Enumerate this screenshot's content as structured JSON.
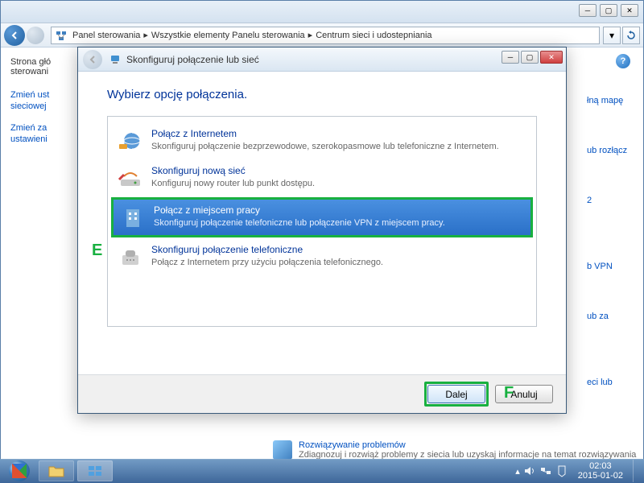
{
  "breadcrumb": {
    "item1": "Panel sterowania",
    "item2": "Wszystkie elementy Panelu sterowania",
    "item3": "Centrum sieci i udostepniania",
    "sep": " ▸ "
  },
  "sidebar": {
    "home1": "Strona głó",
    "home2": "sterowani",
    "link1a": "Zmień ust",
    "link1b": "sieciowej",
    "link2a": "Zmień za",
    "link2b": "ustawieni"
  },
  "right": {
    "r1": "łną mapę",
    "r2": "ub rozłącz",
    "r3": "2",
    "r4": "b VPN",
    "r5": "ub za",
    "r6": "eci lub"
  },
  "bottom": {
    "link": "Rozwiązywanie problemów",
    "text": "Zdiagnozuj i rozwiąż problemy z siecia lub uzyskaj informacje na temat rozwiązywania"
  },
  "wizard": {
    "title": "Skonfiguruj połączenie lub sieć",
    "heading": "Wybierz opcję połączenia.",
    "options": [
      {
        "title": "Połącz z Internetem",
        "desc": "Skonfiguruj połączenie bezprzewodowe, szerokopasmowe lub telefoniczne z Internetem."
      },
      {
        "title": "Skonfiguruj nową sieć",
        "desc": "Konfiguruj nowy router lub punkt dostępu."
      },
      {
        "title": "Połącz z miejscem pracy",
        "desc": "Skonfiguruj połączenie telefoniczne lub połączenie VPN z miejscem pracy."
      },
      {
        "title": "Skonfiguruj połączenie telefoniczne",
        "desc": "Połącz z Internetem przy użyciu połączenia telefonicznego."
      }
    ],
    "next": "Dalej",
    "cancel": "Anuluj"
  },
  "annotations": {
    "e": "E",
    "f": "F"
  },
  "tray": {
    "time": "02:03",
    "date": "2015-01-02"
  }
}
